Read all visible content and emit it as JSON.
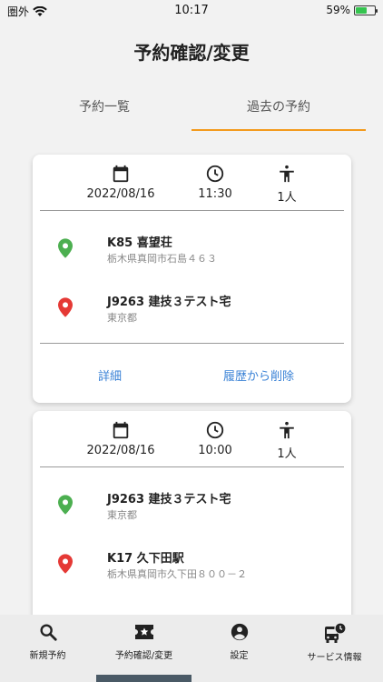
{
  "status": {
    "carrier": "圏外",
    "time": "10:17",
    "battery": "59%",
    "battery_fraction": 0.59,
    "battery_color": "#35c44f"
  },
  "header": {
    "title": "予約確認/変更"
  },
  "tabs": [
    {
      "label": "予約一覧",
      "active": false
    },
    {
      "label": "過去の予約",
      "active": true
    }
  ],
  "accent_color": "#f39a1c",
  "reservations": [
    {
      "date": "2022/08/16",
      "time": "11:30",
      "people": "1人",
      "from": {
        "name": "K85 喜望荘",
        "address": "栃木県真岡市石島４６３",
        "pin_color": "#4caf50"
      },
      "to": {
        "name": "J9263 建技３テスト宅",
        "address": "東京都",
        "pin_color": "#e53935"
      },
      "actions": {
        "detail": "詳細",
        "delete": "履歴から削除"
      }
    },
    {
      "date": "2022/08/16",
      "time": "10:00",
      "people": "1人",
      "from": {
        "name": "J9263 建技３テスト宅",
        "address": "東京都",
        "pin_color": "#4caf50"
      },
      "to": {
        "name": "K17 久下田駅",
        "address": "栃木県真岡市久下田８００－２",
        "pin_color": "#e53935"
      }
    }
  ],
  "bottom_nav": [
    {
      "label": "新規予約",
      "icon": "search-icon"
    },
    {
      "label": "予約確認/変更",
      "icon": "ticket-icon",
      "active": true
    },
    {
      "label": "設定",
      "icon": "account-circle-icon"
    },
    {
      "label": "サービス情報",
      "icon": "bus-clock-icon"
    }
  ]
}
